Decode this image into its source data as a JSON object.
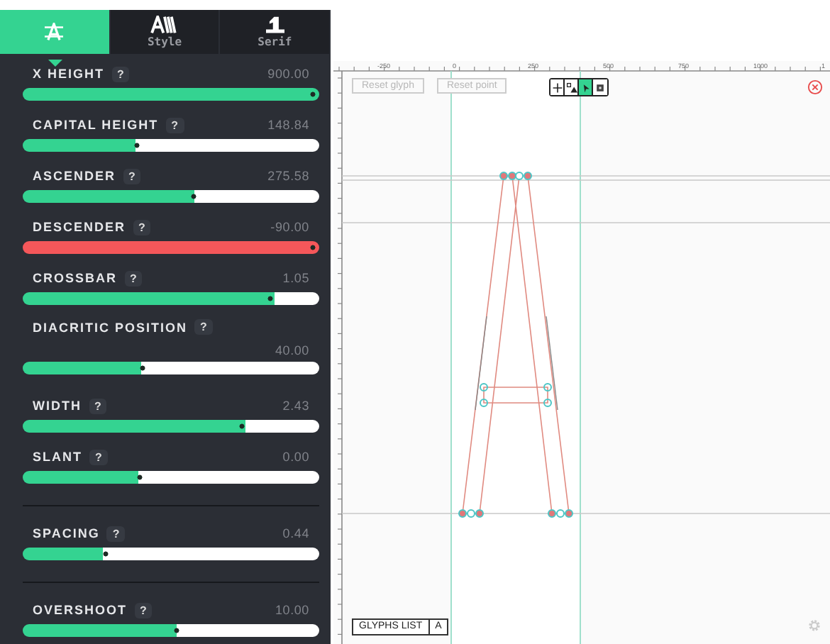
{
  "tabs": [
    {
      "kind": "height",
      "selected": true
    },
    {
      "kind": "style",
      "label": "Style",
      "selected": false
    },
    {
      "kind": "serif",
      "label": "Serif",
      "selected": false
    }
  ],
  "controls": [
    {
      "kind": "slider",
      "label": "X HEIGHT",
      "help": "?",
      "value": "900.00",
      "level": 1.0,
      "color": "#34d391"
    },
    {
      "kind": "slider",
      "label": "CAPITAL HEIGHT",
      "help": "?",
      "value": "148.84",
      "level": 0.38,
      "color": "#34d391"
    },
    {
      "kind": "slider",
      "label": "ASCENDER",
      "help": "?",
      "value": "275.58",
      "level": 0.58,
      "color": "#34d391"
    },
    {
      "kind": "slider",
      "label": "DESCENDER",
      "help": "?",
      "value": "-90.00",
      "level": 1.0,
      "color": "#f5575a"
    },
    {
      "kind": "slider",
      "label": "CROSSBAR",
      "help": "?",
      "value": "1.05",
      "level": 0.85,
      "color": "#34d391"
    },
    {
      "kind": "stacked",
      "label": "DIACRITIC POSITION",
      "help": "?",
      "value": "40.00",
      "level": 0.4,
      "color": "#34d391"
    },
    {
      "kind": "slider",
      "label": "WIDTH",
      "help": "?",
      "value": "2.43",
      "level": 0.75,
      "color": "#34d391"
    },
    {
      "kind": "slider",
      "label": "SLANT",
      "help": "?",
      "value": "0.00",
      "level": 0.39,
      "color": "#34d391"
    },
    {
      "kind": "divider"
    },
    {
      "kind": "slider",
      "label": "SPACING",
      "help": "?",
      "value": "0.44",
      "level": 0.27,
      "color": "#34d391"
    },
    {
      "kind": "divider"
    },
    {
      "kind": "slider",
      "label": "OVERSHOOT",
      "help": "?",
      "value": "10.00",
      "level": 0.52,
      "color": "#34d391"
    }
  ],
  "canvas": {
    "ruler": [
      "-250",
      "0",
      "250",
      "500",
      "750",
      "1000",
      "1"
    ],
    "buttons": [
      {
        "label": "Reset glyph",
        "disabled": true
      },
      {
        "label": "Reset point",
        "disabled": true
      }
    ],
    "tools": [
      {
        "kind": "move",
        "selected": false
      },
      {
        "kind": "points",
        "selected": false
      },
      {
        "kind": "select",
        "selected": true
      },
      {
        "kind": "delete",
        "selected": false
      }
    ],
    "glyphs_list": {
      "label": "GLYPHS LIST",
      "glyph": "A"
    }
  }
}
